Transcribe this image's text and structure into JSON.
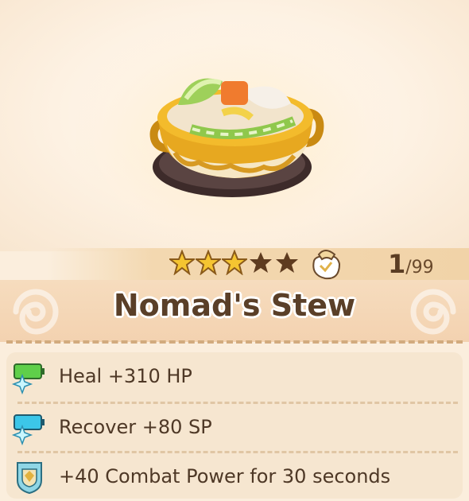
{
  "item": {
    "name": "Nomad's Stew",
    "image_icon": "stew-pot",
    "rating": 3,
    "rating_max": 5,
    "owned_count": "1",
    "owned_max": "/99"
  },
  "effects": [
    {
      "icon": "hp-battery-sparkle-icon",
      "text": "Heal +310 HP"
    },
    {
      "icon": "sp-battery-sparkle-icon",
      "text": "Recover +80 SP"
    },
    {
      "icon": "combat-power-shield-icon",
      "text": "+40 Combat Power for 30 seconds"
    }
  ],
  "colors": {
    "star_filled": "#f5c531",
    "star_empty": "#5e3b1f",
    "title_text": "#5a3f28",
    "hp_green": "#5fcf4a",
    "sp_blue": "#3cc6e8"
  }
}
